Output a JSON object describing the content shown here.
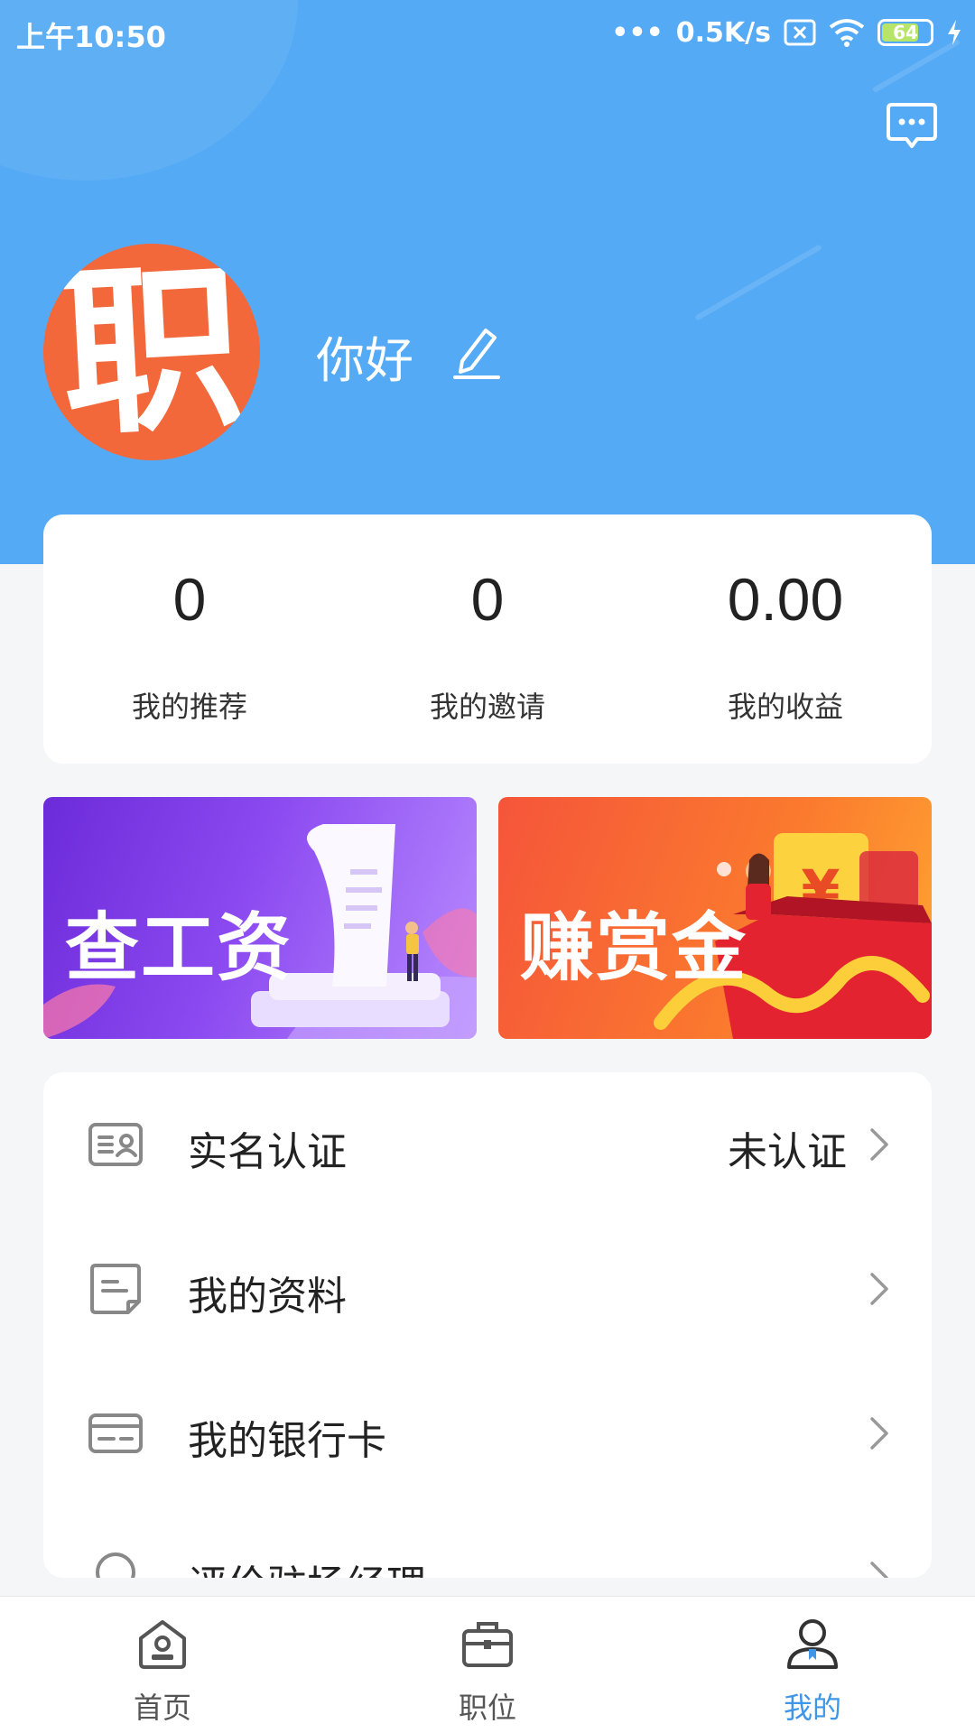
{
  "status_bar": {
    "time": "上午10:50",
    "network_speed": "0.5K/s",
    "battery": "64"
  },
  "profile": {
    "avatar_char": "职",
    "greeting": "你好"
  },
  "stats": [
    {
      "value": "0",
      "label": "我的推荐"
    },
    {
      "value": "0",
      "label": "我的邀请"
    },
    {
      "value": "0.00",
      "label": "我的收益"
    }
  ],
  "banners": {
    "salary": "查工资",
    "reward": "赚赏金"
  },
  "menu": [
    {
      "label": "实名认证",
      "value": "未认证",
      "icon": "id-card-icon"
    },
    {
      "label": "我的资料",
      "value": "",
      "icon": "document-icon"
    },
    {
      "label": "我的银行卡",
      "value": "",
      "icon": "bank-card-icon"
    },
    {
      "label": "评价驻场经理",
      "value": "",
      "icon": "badge-icon"
    }
  ],
  "tabbar": [
    {
      "label": "首页",
      "icon": "home-icon",
      "active": false
    },
    {
      "label": "职位",
      "icon": "briefcase-icon",
      "active": false
    },
    {
      "label": "我的",
      "icon": "user-icon",
      "active": true
    }
  ],
  "colors": {
    "header_bg": "#55aaf5",
    "accent": "#3f95e6",
    "avatar_bg": "#f2683a"
  }
}
